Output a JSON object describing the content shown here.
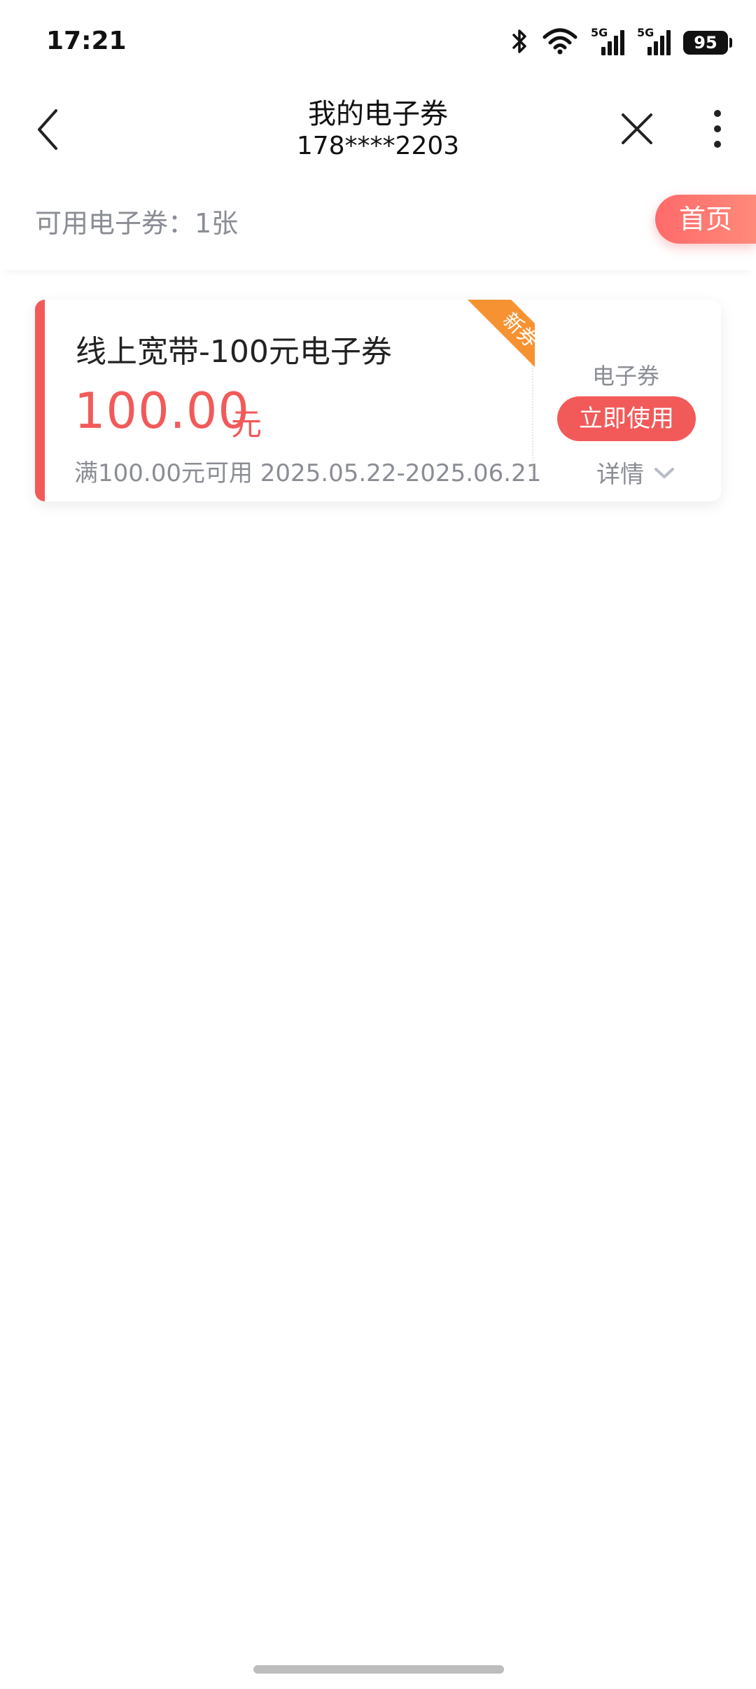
{
  "status_bar": {
    "time": "17:21",
    "network_label_1": "5G",
    "network_label_2": "5G",
    "battery": "95",
    "icons": [
      "bluetooth-icon",
      "wifi-icon",
      "signal-5g-icon",
      "signal-5g-icon",
      "battery-icon"
    ]
  },
  "header": {
    "title": "我的电子券",
    "subtitle": "178****2203",
    "icons": [
      "back-arrow-icon",
      "close-icon",
      "more-vertical-icon"
    ]
  },
  "summary": {
    "available_text": "可用电子券：1张",
    "home_button": "首页"
  },
  "coupons": [
    {
      "name": "线上宽带-100元电子券",
      "amount": "100.00",
      "unit": "元",
      "condition": "满100.00元可用 2025.05.22-2025.06.21",
      "badge": "新券",
      "type_label": "电子券",
      "use_button": "立即使用",
      "detail_label": "详情"
    }
  ],
  "colors": {
    "accent_red": "#f25a5a",
    "badge_orange": "#f79232",
    "muted_text": "#8a8d94"
  }
}
